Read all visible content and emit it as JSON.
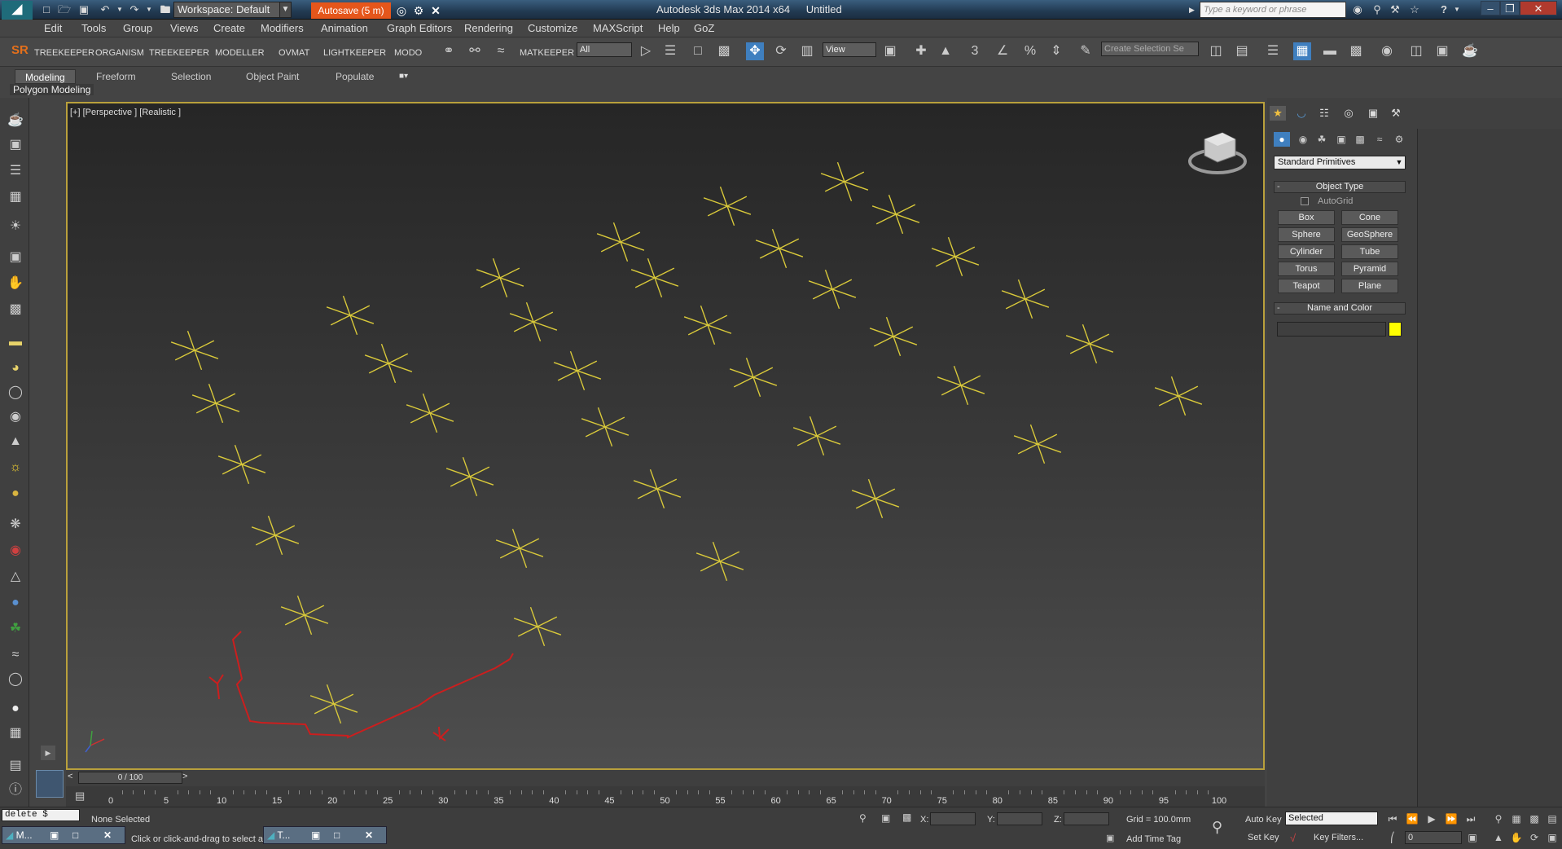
{
  "titlebar": {
    "workspace": "Workspace: Default",
    "autosave": "Autosave (5 m)",
    "app_title": "Autodesk 3ds Max  2014 x64",
    "doc_title": "Untitled",
    "search_placeholder": "Type a keyword or phrase",
    "minimize": "–",
    "restore": "❐",
    "close": "✕"
  },
  "menu": [
    "Edit",
    "Tools",
    "Group",
    "Views",
    "Create",
    "Modifiers",
    "Animation",
    "Graph Editors",
    "Rendering",
    "Customize",
    "MAXScript",
    "Help",
    "GoZ"
  ],
  "toolbar": {
    "plugins": [
      "SR",
      "TREEKEEPER",
      "ORGANISM",
      "TREEKEEPER",
      "MODELLER",
      "OVMAT",
      "LIGHTKEEPER",
      "MODO"
    ],
    "matkeeper": "MATKEEPER",
    "filter_value": "All",
    "refcoord_value": "View",
    "snap_label": "3",
    "named_selection_placeholder": "Create Selection Se"
  },
  "ribbon": {
    "tabs": [
      "Modeling",
      "Freeform",
      "Selection",
      "Object Paint",
      "Populate"
    ],
    "active_tab": "Modeling",
    "sub_label": "Polygon Modeling"
  },
  "viewport": {
    "label": "[+] [Perspective ] [Realistic ]",
    "star_color": "#d9c93a",
    "spline_color": "#cc1e1e",
    "border_color": "#b9a03c"
  },
  "command_panel": {
    "category": "Standard Primitives",
    "object_type_title": "Object Type",
    "autogrid_label": "AutoGrid",
    "buttons": [
      [
        "Box",
        "Cone"
      ],
      [
        "Sphere",
        "GeoSphere"
      ],
      [
        "Cylinder",
        "Tube"
      ],
      [
        "Torus",
        "Pyramid"
      ],
      [
        "Teapot",
        "Plane"
      ]
    ],
    "name_color_title": "Name and Color",
    "object_color": "#ffff00"
  },
  "timeline": {
    "frame_display": "0 / 100",
    "prev": "<",
    "next": ">",
    "ticks": [
      "0",
      "5",
      "10",
      "15",
      "20",
      "25",
      "30",
      "35",
      "40",
      "45",
      "50",
      "55",
      "60",
      "65",
      "70",
      "75",
      "80",
      "85",
      "90",
      "95",
      "100"
    ]
  },
  "status": {
    "maxscript_listener": "delete $",
    "selection_status": "None Selected",
    "prompt": "Click or click-and-drag to select and move objects",
    "x_label": "X:",
    "y_label": "Y:",
    "z_label": "Z:",
    "grid": "Grid = 100.0mm",
    "add_time_tag": "Add Time Tag",
    "auto_key": "Auto Key",
    "set_key": "Set Key",
    "key_filters": "Key Filters...",
    "selection_filter": "Selected",
    "current_frame": "0"
  },
  "taskbar": {
    "item1": "M...",
    "item2": "T..."
  }
}
